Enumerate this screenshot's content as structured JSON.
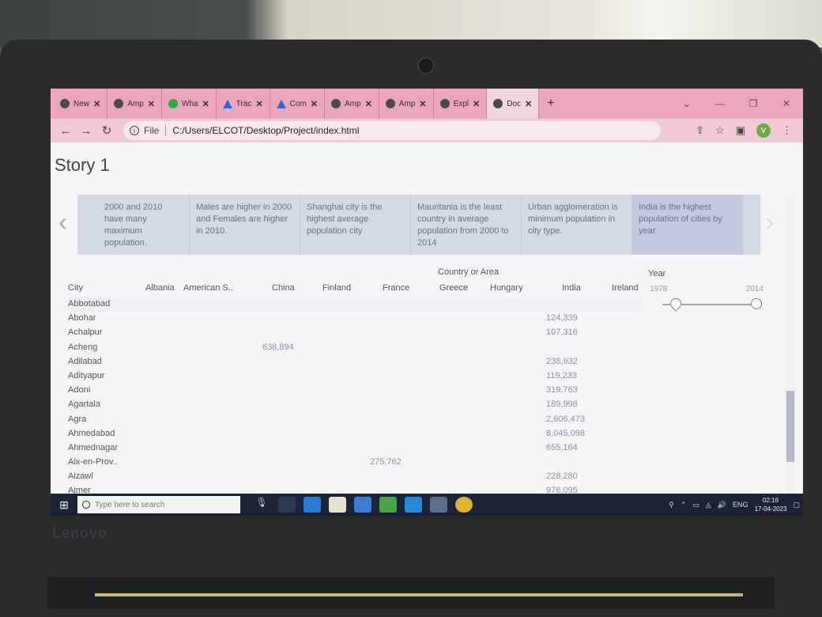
{
  "browser": {
    "tabs": [
      {
        "label": "New",
        "icon": "chrome-icon"
      },
      {
        "label": "Amp",
        "icon": "web-icon"
      },
      {
        "label": "Wha",
        "icon": "whatsapp-icon"
      },
      {
        "label": "Trac",
        "icon": "drive-icon"
      },
      {
        "label": "Com",
        "icon": "drive-icon"
      },
      {
        "label": "Amp",
        "icon": "web-icon"
      },
      {
        "label": "Amp",
        "icon": "ampere-icon"
      },
      {
        "label": "Expl",
        "icon": "wallet-icon"
      },
      {
        "label": "Doc",
        "icon": "web-icon",
        "active": true
      }
    ],
    "close_glyph": "✕",
    "new_tab_glyph": "+",
    "file_label": "File",
    "url": "C:/Users/ELCOT/Desktop/Project/index.html",
    "avatar_letter": "V",
    "accent_color": "#e9a6bd"
  },
  "story": {
    "title": "Story 1",
    "points": [
      "2000 and 2010 have many maximum population.",
      "Males are higher in 2000 and Females are higher in 2010.",
      "Shanghai city is the highest average population city",
      "Mauritania is the least country in average population from 2000 to 2014",
      "Urban agglomeration is minimum population in city type.",
      "India is the highest population of cities by year"
    ],
    "active_point": 5
  },
  "table": {
    "columns_group_title": "Country or Area",
    "city_header": "City",
    "countries": [
      "Albania",
      "American S..",
      "China",
      "Finland",
      "France",
      "Greece",
      "Hungary",
      "India",
      "Ireland"
    ],
    "rows": [
      {
        "city": "Abbotabad",
        "values": {}
      },
      {
        "city": "Abohar",
        "values": {
          "India": "124,339"
        }
      },
      {
        "city": "Achalpur",
        "values": {
          "India": "107,316"
        }
      },
      {
        "city": "Acheng",
        "values": {
          "China": "638,894"
        }
      },
      {
        "city": "Adilabad",
        "values": {
          "India": "238,932"
        }
      },
      {
        "city": "Adityapur",
        "values": {
          "India": "119,233"
        }
      },
      {
        "city": "Adoni",
        "values": {
          "India": "319,763"
        }
      },
      {
        "city": "Agartala",
        "values": {
          "India": "189,998"
        }
      },
      {
        "city": "Agra",
        "values": {
          "India": "2,606,473"
        }
      },
      {
        "city": "Ahmedabad",
        "values": {
          "India": "8,045,098"
        }
      },
      {
        "city": "Ahmednagar",
        "values": {
          "India": "655,164"
        }
      },
      {
        "city": "Aix-en-Prov..",
        "values": {
          "France": "275,762"
        }
      },
      {
        "city": "Aizawl",
        "values": {
          "India": "228,280"
        }
      },
      {
        "city": "Ajmer",
        "values": {
          "India": "976,095"
        }
      }
    ]
  },
  "year_filter": {
    "title": "Year",
    "min": "1978",
    "max": "2014"
  },
  "taskbar": {
    "search_placeholder": "Type here to search",
    "lang": "ENG",
    "time": "02:16",
    "date": "17-04-2023"
  },
  "device": {
    "brand": "Lenovo"
  }
}
